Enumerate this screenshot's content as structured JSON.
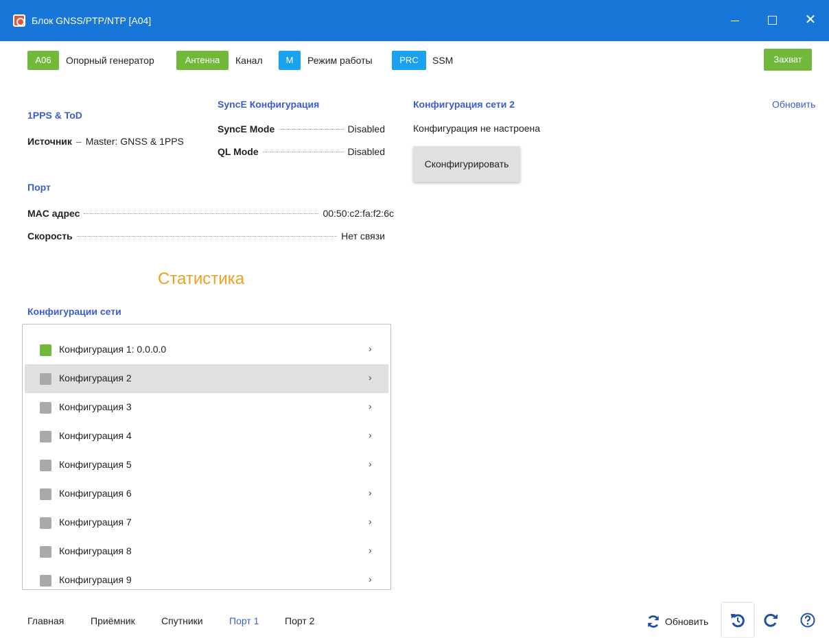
{
  "window": {
    "title": "Блок GNSS/PTP/NTP [A04]",
    "minimize_icon": "minimize-icon",
    "maximize_icon": "maximize-icon",
    "close_icon": "close-icon",
    "close_glyph": "✕"
  },
  "status_bar": {
    "items": [
      {
        "badge": "A06",
        "label": "Опорный генератор",
        "color": "#72b83a"
      },
      {
        "badge": "Антенна",
        "label": "Канал",
        "color": "#72b83a"
      },
      {
        "badge": "M",
        "label": "Режим работы",
        "color": "#1aa1f0"
      },
      {
        "badge": "PRC",
        "label": "SSM",
        "color": "#1aa1f0"
      }
    ],
    "capture_label": "Захват"
  },
  "pps": {
    "title": "1PPS & ToD",
    "source_key": "Источник",
    "source_dash": "–",
    "source_value": "Master: GNSS & 1PPS"
  },
  "synce": {
    "title": "SyncE Конфигурация",
    "mode_key": "SyncE Mode",
    "mode_value": "Disabled",
    "ql_key": "QL Mode",
    "ql_value": "Disabled"
  },
  "port": {
    "title": "Порт",
    "mac_key": "MAC адрес",
    "mac_value": "00:50:c2:fa:f2:6c",
    "speed_key": "Скорость",
    "speed_value": "Нет связи"
  },
  "net_config_2": {
    "title": "Конфигурация сети 2",
    "status": "Конфигурация не настроена",
    "configure_label": "Сконфигурировать",
    "refresh_link": "Обновить"
  },
  "statistics_heading": "Статистика",
  "net_list": {
    "title": "Конфигурации сети",
    "items": [
      {
        "label": "Конфигурация 1: 0.0.0.0",
        "active": true
      },
      {
        "label": "Конфигурация 2",
        "selected": true
      },
      {
        "label": "Конфигурация 3"
      },
      {
        "label": "Конфигурация 4"
      },
      {
        "label": "Конфигурация 5"
      },
      {
        "label": "Конфигурация 6"
      },
      {
        "label": "Конфигурация 7"
      },
      {
        "label": "Конфигурация 8"
      },
      {
        "label": "Конфигурация 9"
      }
    ],
    "chevron": "›"
  },
  "bottom_nav": {
    "tabs": [
      "Главная",
      "Приёмник",
      "Спутники",
      "Порт 1",
      "Порт 2"
    ],
    "active_tab": "Порт 1"
  },
  "toolbar": {
    "refresh_label": "Обновить",
    "refresh_icon": "refresh-icon",
    "undo_icon": "history-undo-icon",
    "redo_icon": "redo-icon",
    "help_icon": "help-icon"
  },
  "colors": {
    "titlebar": "#1876d8",
    "green": "#72b83a",
    "blue": "#1aa1f0",
    "accent_text": "#3b5bd0",
    "stat_heading": "#f0a01e"
  }
}
